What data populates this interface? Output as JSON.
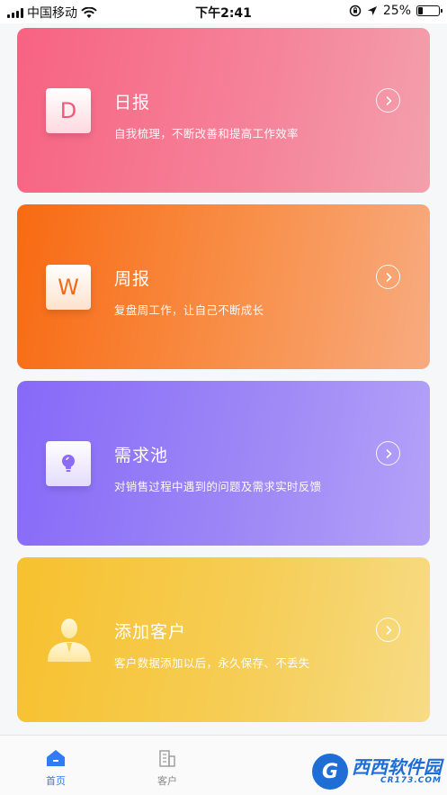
{
  "status_bar": {
    "carrier": "中国移动",
    "time": "下午2:41",
    "battery_percent": "25%",
    "battery_level": 0.25
  },
  "cards": [
    {
      "icon_letter": "D",
      "title": "日报",
      "description": "自我梳理，不断改善和提高工作效率",
      "color": "#f76382"
    },
    {
      "icon_letter": "W",
      "title": "周报",
      "description": "复盘周工作，让自己不断成长",
      "color": "#f86a12"
    },
    {
      "icon": "lightbulb-icon",
      "title": "需求池",
      "description": "对销售过程中遇到的问题及需求实时反馈",
      "color": "#8769f8"
    },
    {
      "icon": "person-icon",
      "title": "添加客户",
      "description": "客户数据添加以后，永久保存、不丢失",
      "color": "#f7c12e"
    }
  ],
  "tabbar": {
    "home_label": "首页",
    "customer_label": "客户",
    "active_color": "#2f7cf6"
  },
  "watermark": {
    "text": "西西软件园",
    "sub": "CR173.COM"
  }
}
